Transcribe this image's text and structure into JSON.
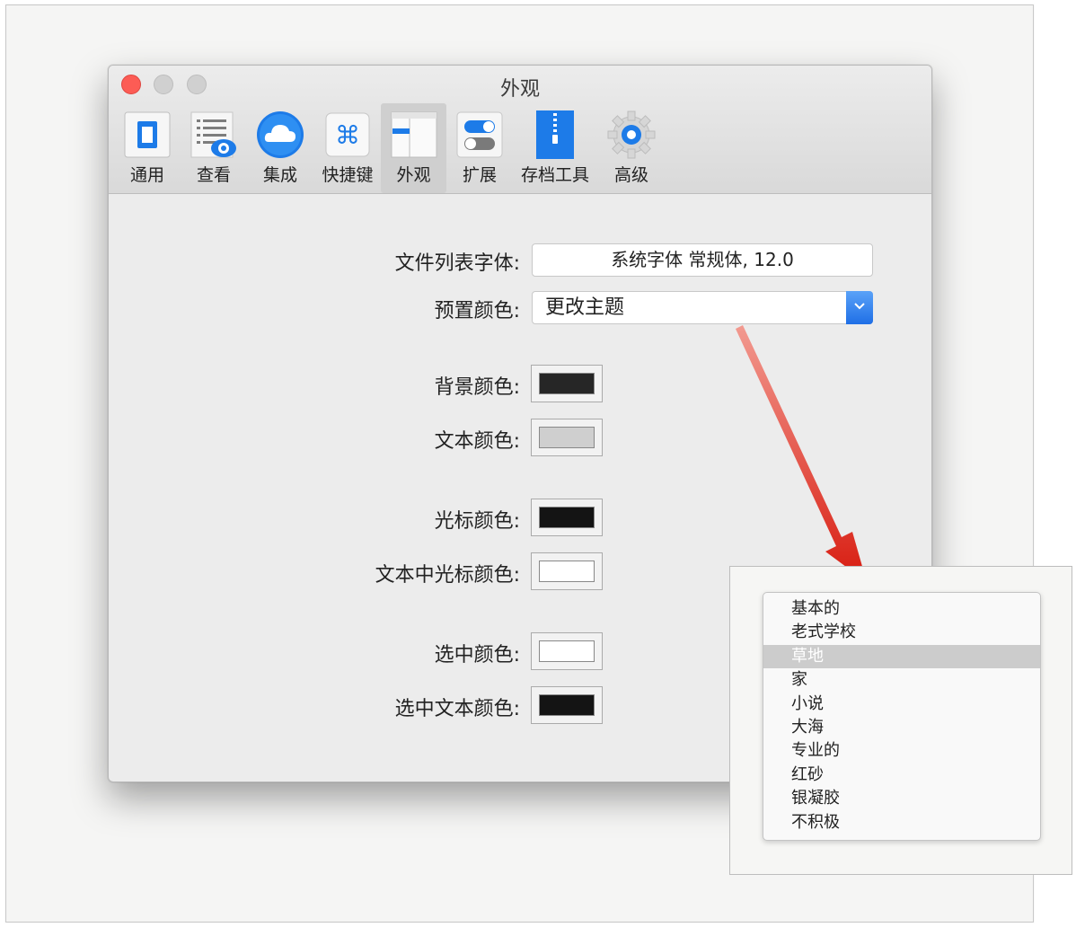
{
  "window": {
    "title": "外观"
  },
  "toolbar": {
    "items": [
      {
        "label": "通用",
        "icon": "switch-icon"
      },
      {
        "label": "查看",
        "icon": "list-eye-icon"
      },
      {
        "label": "集成",
        "icon": "cloud-icon"
      },
      {
        "label": "快捷键",
        "icon": "command-icon"
      },
      {
        "label": "外观",
        "icon": "window-layout-icon",
        "selected": true
      },
      {
        "label": "扩展",
        "icon": "toggles-icon"
      },
      {
        "label": "存档工具",
        "icon": "zip-icon"
      },
      {
        "label": "高级",
        "icon": "gear-icon"
      }
    ]
  },
  "form": {
    "font_label": "文件列表字体:",
    "font_value": "系统字体 常规体, 12.0",
    "preset_label": "预置颜色:",
    "preset_value": "更改主题",
    "colors": [
      {
        "label": "背景颜色:",
        "color": "#262626"
      },
      {
        "label": "文本颜色:",
        "color": "#cfcfcf"
      },
      {
        "label": "光标颜色:",
        "color": "#141414"
      },
      {
        "label": "文本中光标颜色:",
        "color": "#ffffff"
      },
      {
        "label": "选中颜色:",
        "color": "#ffffff"
      },
      {
        "label": "选中文本颜色:",
        "color": "#141414"
      }
    ]
  },
  "theme_menu": {
    "items": [
      "基本的",
      "老式学校",
      "草地",
      "家",
      "小说",
      "大海",
      "专业的",
      "红砂",
      "银凝胶",
      "不积极"
    ],
    "highlighted_index": 2
  },
  "accent_color": "#1d7be8",
  "arrow_color": "#e0261a"
}
